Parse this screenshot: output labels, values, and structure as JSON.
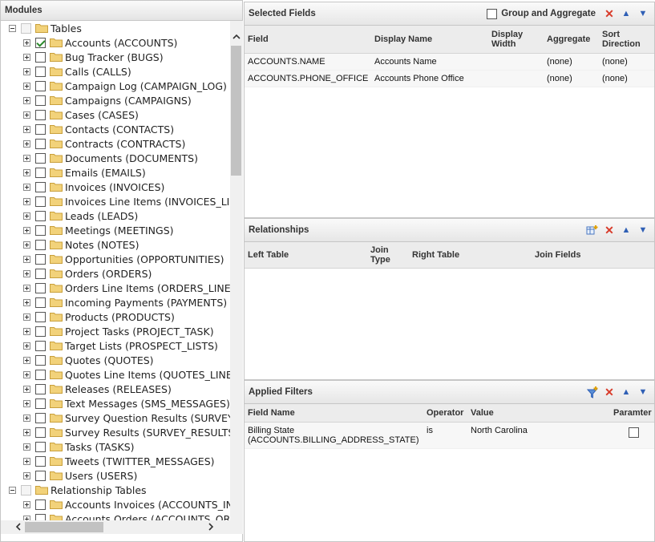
{
  "modules": {
    "title": "Modules",
    "nodes": [
      {
        "level": 0,
        "label": "Tables",
        "checked": false,
        "disabled": true,
        "expanded": true
      },
      {
        "level": 1,
        "label": "Accounts (ACCOUNTS)",
        "checked": true
      },
      {
        "level": 1,
        "label": "Bug Tracker (BUGS)",
        "checked": false
      },
      {
        "level": 1,
        "label": "Calls (CALLS)",
        "checked": false
      },
      {
        "level": 1,
        "label": "Campaign Log (CAMPAIGN_LOG)",
        "checked": false
      },
      {
        "level": 1,
        "label": "Campaigns (CAMPAIGNS)",
        "checked": false
      },
      {
        "level": 1,
        "label": "Cases (CASES)",
        "checked": false
      },
      {
        "level": 1,
        "label": "Contacts (CONTACTS)",
        "checked": false
      },
      {
        "level": 1,
        "label": "Contracts (CONTRACTS)",
        "checked": false
      },
      {
        "level": 1,
        "label": "Documents (DOCUMENTS)",
        "checked": false
      },
      {
        "level": 1,
        "label": "Emails (EMAILS)",
        "checked": false
      },
      {
        "level": 1,
        "label": "Invoices (INVOICES)",
        "checked": false
      },
      {
        "level": 1,
        "label": "Invoices Line Items (INVOICES_LI",
        "checked": false
      },
      {
        "level": 1,
        "label": "Leads (LEADS)",
        "checked": false
      },
      {
        "level": 1,
        "label": "Meetings (MEETINGS)",
        "checked": false
      },
      {
        "level": 1,
        "label": "Notes (NOTES)",
        "checked": false
      },
      {
        "level": 1,
        "label": "Opportunities (OPPORTUNITIES)",
        "checked": false
      },
      {
        "level": 1,
        "label": "Orders (ORDERS)",
        "checked": false
      },
      {
        "level": 1,
        "label": "Orders Line Items (ORDERS_LINE_",
        "checked": false
      },
      {
        "level": 1,
        "label": "Incoming Payments (PAYMENTS)",
        "checked": false
      },
      {
        "level": 1,
        "label": "Products (PRODUCTS)",
        "checked": false
      },
      {
        "level": 1,
        "label": "Project Tasks (PROJECT_TASK)",
        "checked": false
      },
      {
        "level": 1,
        "label": "Target Lists (PROSPECT_LISTS)",
        "checked": false
      },
      {
        "level": 1,
        "label": "Quotes (QUOTES)",
        "checked": false
      },
      {
        "level": 1,
        "label": "Quotes Line Items (QUOTES_LINE_",
        "checked": false
      },
      {
        "level": 1,
        "label": "Releases (RELEASES)",
        "checked": false
      },
      {
        "level": 1,
        "label": "Text Messages (SMS_MESSAGES)",
        "checked": false
      },
      {
        "level": 1,
        "label": "Survey Question Results (SURVEY_",
        "checked": false
      },
      {
        "level": 1,
        "label": "Survey Results (SURVEY_RESULTS",
        "checked": false
      },
      {
        "level": 1,
        "label": "Tasks (TASKS)",
        "checked": false
      },
      {
        "level": 1,
        "label": "Tweets (TWITTER_MESSAGES)",
        "checked": false
      },
      {
        "level": 1,
        "label": "Users (USERS)",
        "checked": false
      },
      {
        "level": 0,
        "label": "Relationship Tables",
        "checked": false,
        "disabled": true,
        "expanded": true
      },
      {
        "level": 1,
        "label": "Accounts Invoices (ACCOUNTS_INV",
        "checked": false
      },
      {
        "level": 1,
        "label": "Accounts Orders (ACCOUNTS_ORD",
        "checked": false
      }
    ]
  },
  "selected_fields": {
    "title": "Selected Fields",
    "group_label": "Group and Aggregate",
    "columns": [
      "Field",
      "Display Name",
      "Display Width",
      "Aggregate",
      "Sort Direction"
    ],
    "rows": [
      [
        "ACCOUNTS.NAME",
        "Accounts Name",
        "",
        "(none)",
        "(none)"
      ],
      [
        "ACCOUNTS.PHONE_OFFICE",
        "Accounts Phone Office",
        "",
        "(none)",
        "(none)"
      ]
    ]
  },
  "relationships": {
    "title": "Relationships",
    "columns": [
      "Left Table",
      "Join Type",
      "Right Table",
      "Join Fields"
    ]
  },
  "applied_filters": {
    "title": "Applied Filters",
    "columns": [
      "Field Name",
      "Operator",
      "Value",
      "Paramter"
    ],
    "rows": [
      {
        "field": "Billing State (ACCOUNTS.BILLING_ADDRESS_STATE)",
        "operator": "is",
        "value": "North Carolina",
        "param": false
      }
    ]
  },
  "colors": {
    "folder": "#f2d27a",
    "delete": "#d83b2a",
    "arrow": "#2f5fb5",
    "check": "#2b8a2b"
  }
}
